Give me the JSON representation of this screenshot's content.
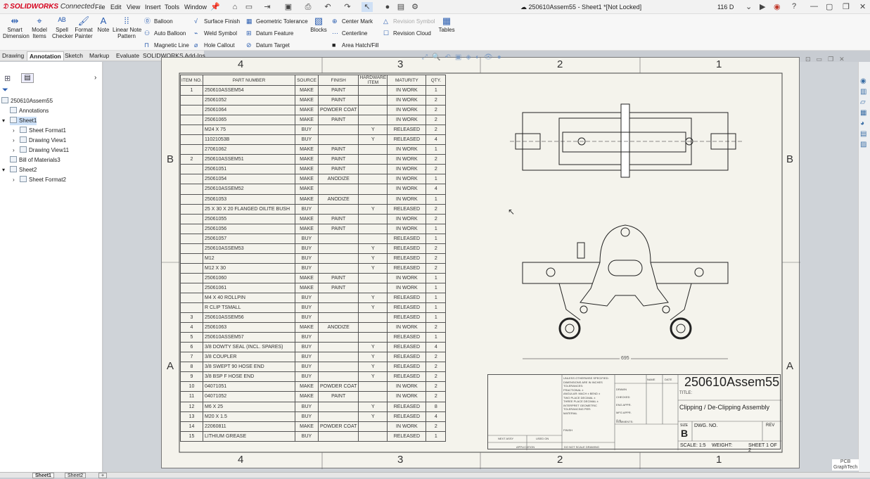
{
  "app": {
    "brand": "SOLIDWORKS",
    "brand_suffix": "Connected",
    "menus": [
      "File",
      "Edit",
      "View",
      "Insert",
      "Tools",
      "Window"
    ],
    "doc_title": "250610Assem55 - Sheet1 *[Not Locked]",
    "zoom": "116 D"
  },
  "ribbon": {
    "big": [
      {
        "label1": "Smart",
        "label2": "Dimension"
      },
      {
        "label1": "Model",
        "label2": "Items"
      },
      {
        "label1": "Spell",
        "label2": "Checker"
      },
      {
        "label1": "Format",
        "label2": "Painter"
      },
      {
        "label1": "Note",
        "label2": ""
      },
      {
        "label1": "Linear Note",
        "label2": "Pattern"
      }
    ],
    "col1": [
      "Balloon",
      "Auto Balloon",
      "Magnetic Line"
    ],
    "col2": [
      "Surface Finish",
      "Weld Symbol",
      "Hole Callout"
    ],
    "col3": [
      "Geometric Tolerance",
      "Datum Feature",
      "Datum Target"
    ],
    "blocks": "Blocks",
    "col4": [
      "Center Mark",
      "Centerline",
      "Area Hatch/Fill"
    ],
    "col5": [
      "Revision Symbol",
      "Revision Cloud"
    ],
    "tables": "Tables"
  },
  "tabs": [
    "Drawing",
    "Annotation",
    "Sketch",
    "Markup",
    "Evaluate",
    "SOLIDWORKS Add-Ins"
  ],
  "tree": [
    "250610Assem55",
    "Annotations",
    "Sheet1",
    "Sheet Format1",
    "Drawing View1",
    "Drawing View11",
    "Bill of Materials3",
    "Sheet2",
    "Sheet Format2"
  ],
  "zones": {
    "top": [
      "4",
      "3",
      "2",
      "1"
    ],
    "side": [
      "B",
      "A"
    ]
  },
  "bom": {
    "headers": [
      "ITEM NO.",
      "PART NUMBER",
      "SOURCE",
      "FINISH",
      "HARDWARE ITEM",
      "MATURITY",
      "QTY."
    ],
    "rows": [
      [
        "1",
        "250610ASSEM54",
        "MAKE",
        "PAINT",
        "",
        "IN WORK",
        "1"
      ],
      [
        "",
        "25061052",
        "MAKE",
        "PAINT",
        "",
        "IN WORK",
        "2"
      ],
      [
        "",
        "25061064",
        "MAKE",
        "POWDER COAT",
        "",
        "IN WORK",
        "2"
      ],
      [
        "",
        "25061065",
        "MAKE",
        "PAINT",
        "",
        "IN WORK",
        "2"
      ],
      [
        "",
        "M24 X 75",
        "BUY",
        "",
        "Y",
        "RELEASED",
        "2"
      ],
      [
        "",
        "11021053B",
        "BUY",
        "",
        "Y",
        "RELEASED",
        "4"
      ],
      [
        "",
        "27061062",
        "MAKE",
        "PAINT",
        "",
        "IN WORK",
        "1"
      ],
      [
        "2",
        "250610ASSEM51",
        "MAKE",
        "PAINT",
        "",
        "IN WORK",
        "2"
      ],
      [
        "",
        "25061051",
        "MAKE",
        "PAINT",
        "",
        "IN WORK",
        "2"
      ],
      [
        "",
        "25061054",
        "MAKE",
        "ANODIZE",
        "",
        "IN WORK",
        "1"
      ],
      [
        "",
        "250610ASSEM52",
        "MAKE",
        "",
        "",
        "IN WORK",
        "4"
      ],
      [
        "",
        "25061053",
        "MAKE",
        "ANODIZE",
        "",
        "IN WORK",
        "1"
      ],
      [
        "",
        "25 X 30 X 20 FLANGED OILITE BUSH",
        "BUY",
        "",
        "Y",
        "RELEASED",
        "2"
      ],
      [
        "",
        "25061055",
        "MAKE",
        "PAINT",
        "",
        "IN WORK",
        "2"
      ],
      [
        "",
        "25061056",
        "MAKE",
        "PAINT",
        "",
        "IN WORK",
        "1"
      ],
      [
        "",
        "25061057",
        "BUY",
        "",
        "",
        "RELEASED",
        "1"
      ],
      [
        "",
        "250610ASSEM53",
        "BUY",
        "",
        "Y",
        "RELEASED",
        "2"
      ],
      [
        "",
        "M12",
        "BUY",
        "",
        "Y",
        "RELEASED",
        "2"
      ],
      [
        "",
        "M12 X 30",
        "BUY",
        "",
        "Y",
        "RELEASED",
        "2"
      ],
      [
        "",
        "25061060",
        "MAKE",
        "PAINT",
        "",
        "IN WORK",
        "1"
      ],
      [
        "",
        "25061061",
        "MAKE",
        "PAINT",
        "",
        "IN WORK",
        "1"
      ],
      [
        "",
        "M4 X 40 ROLLPIN",
        "BUY",
        "",
        "Y",
        "RELEASED",
        "1"
      ],
      [
        "",
        "R CLIP TSMALL",
        "BUY",
        "",
        "Y",
        "RELEASED",
        "1"
      ],
      [
        "3",
        "250610ASSEM56",
        "BUY",
        "",
        "",
        "RELEASED",
        "1"
      ],
      [
        "4",
        "25061063",
        "MAKE",
        "ANODIZE",
        "",
        "IN WORK",
        "2"
      ],
      [
        "5",
        "250610ASSEM57",
        "BUY",
        "",
        "",
        "RELEASED",
        "1"
      ],
      [
        "6",
        "3/8 DOWTY SEAL (INCL. SPARES)",
        "BUY",
        "",
        "Y",
        "RELEASED",
        "4"
      ],
      [
        "7",
        "3/8 COUPLER",
        "BUY",
        "",
        "Y",
        "RELEASED",
        "2"
      ],
      [
        "8",
        "3/8 SWEPT 90 HOSE END",
        "BUY",
        "",
        "Y",
        "RELEASED",
        "2"
      ],
      [
        "9",
        "3/8 BSP F HOSE END",
        "BUY",
        "",
        "Y",
        "RELEASED",
        "2"
      ],
      [
        "10",
        "04071051",
        "MAKE",
        "POWDER COAT",
        "",
        "IN WORK",
        "2"
      ],
      [
        "11",
        "04071052",
        "MAKE",
        "PAINT",
        "",
        "IN WORK",
        "2"
      ],
      [
        "12",
        "M6 X 25",
        "BUY",
        "",
        "Y",
        "RELEASED",
        "8"
      ],
      [
        "13",
        "M20 X 1.5",
        "BUY",
        "",
        "Y",
        "RELEASED",
        "4"
      ],
      [
        "14",
        "22060811",
        "MAKE",
        "POWDER COAT",
        "",
        "IN WORK",
        "2"
      ],
      [
        "15",
        "LITHIUM GREASE",
        "BUY",
        "",
        "",
        "RELEASED",
        "1"
      ]
    ]
  },
  "dimension": "695",
  "titleblock": {
    "number": "250610Assem55",
    "title_label": "TITLE:",
    "title": "Clipping / De-Clipping Assembly",
    "size_label": "SIZE",
    "size": "B",
    "dwg_label": "DWG. NO.",
    "rev_label": "REV",
    "scale": "SCALE: 1:5",
    "weight": "WEIGHT:",
    "sheet": "SHEET 1 OF 2",
    "name": "NAME",
    "date": "DATE",
    "drawn": "DRAWN",
    "checked": "CHECKED",
    "eng": "ENG APPR.",
    "mfg": "MFG APPR.",
    "qa": "Q.A.",
    "comments": "COMMENTS:",
    "unless": "UNLESS OTHERWISE SPECIFIED:",
    "dims": "DIMENSIONS ARE IN INCHES",
    "tol": "TOLERANCES:",
    "frac": "FRACTIONAL ±",
    "ang": "ANGULAR: MACH ±  BEND ±",
    "two": "TWO PLACE DECIMAL ±",
    "three": "THREE PLACE DECIMAL ±",
    "interp": "INTERPRET GEOMETRIC",
    "toler": "TOLERANCING PER:",
    "material": "MATERIAL",
    "finish": "FINISH",
    "next": "NEXT ASSY",
    "used": "USED ON",
    "app": "APPLICATION",
    "noscale": "DO NOT SCALE DRAWING"
  },
  "sheet_tabs": [
    "Sheet1",
    "Sheet2"
  ],
  "watermark": {
    "line1": "PCB",
    "line2": "GraphTech"
  }
}
